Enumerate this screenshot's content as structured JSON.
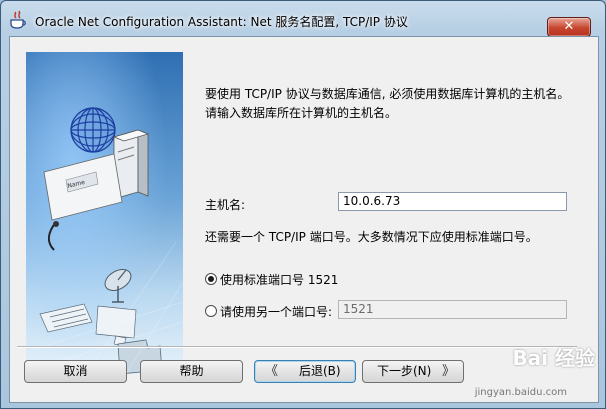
{
  "window": {
    "title": "Oracle Net Configuration Assistant: Net 服务名配置,  TCP/IP 协议",
    "close_symbol": "✕"
  },
  "main": {
    "intro_text": "要使用 TCP/IP 协议与数据库通信, 必须使用数据库计算机的主机名。请输入数据库所在计算机的主机名。",
    "host_label": "主机名:",
    "host_value": "10.0.6.73",
    "port_note": "还需要一个 TCP/IP 端口号。大多数情况下应使用标准端口号。",
    "radio_standard_label": "使用标准端口号 1521",
    "radio_standard_selected": true,
    "radio_other_label": "请使用另一个端口号:",
    "radio_other_selected": false,
    "other_port_value": "1521"
  },
  "buttons": {
    "cancel": "取消",
    "help": "帮助",
    "back": "后退(B)",
    "next": "下一步(N)",
    "back_arrow": "《",
    "next_arrow": "》"
  },
  "watermark": {
    "text": "Bai 经验",
    "sub": "jingyan.baidu.com"
  },
  "icons": {
    "title": "java-cup-icon",
    "art": "network-globe-illustration"
  }
}
